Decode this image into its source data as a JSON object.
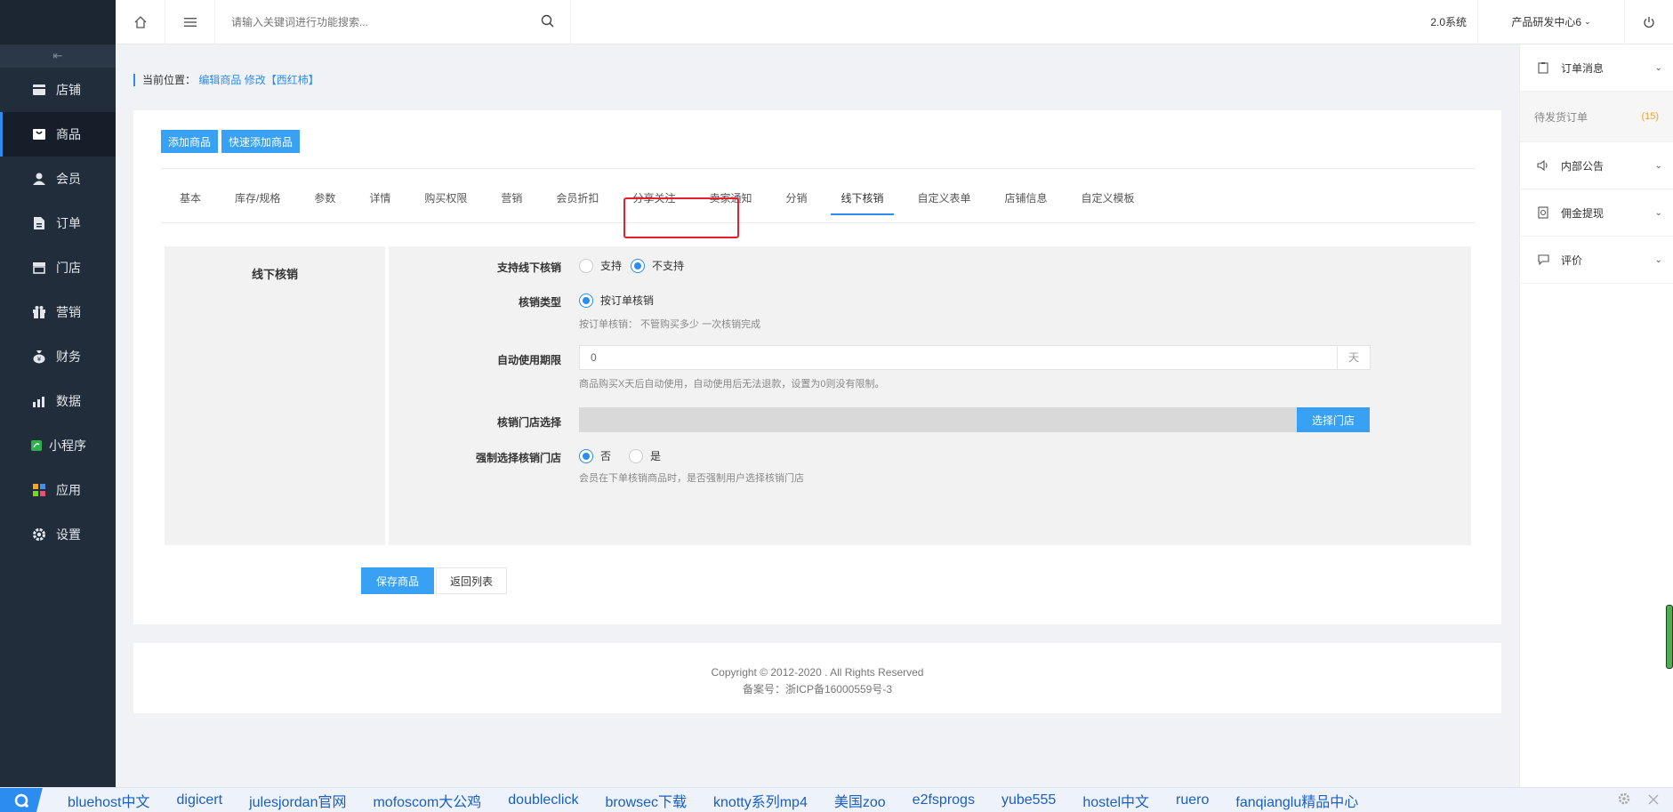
{
  "sidebar": {
    "collapse_glyph": "⇤",
    "items": [
      {
        "label": "店铺",
        "icon": "store-icon"
      },
      {
        "label": "商品",
        "icon": "product-icon",
        "active": true
      },
      {
        "label": "会员",
        "icon": "member-icon"
      },
      {
        "label": "订单",
        "icon": "order-icon"
      },
      {
        "label": "门店",
        "icon": "shop-icon"
      },
      {
        "label": "营销",
        "icon": "gift-icon"
      },
      {
        "label": "财务",
        "icon": "money-bag-icon"
      },
      {
        "label": "数据",
        "icon": "chart-icon"
      },
      {
        "label": "小程序",
        "icon": "miniapp-icon"
      },
      {
        "label": "应用",
        "icon": "apps-icon"
      },
      {
        "label": "设置",
        "icon": "gear-icon"
      }
    ]
  },
  "topbar": {
    "search_placeholder": "请输入关键词进行功能搜索...",
    "system": "2.0系统",
    "org": "产品研发中心6"
  },
  "breadcrumb": {
    "prefix": "当前位置：",
    "links": "编辑商品 修改【西红柿】"
  },
  "actions": {
    "add_product": "添加商品",
    "quick_add": "快速添加商品"
  },
  "tabs": [
    "基本",
    "库存/规格",
    "参数",
    "详情",
    "购买权限",
    "营销",
    "会员折扣",
    "分享关注",
    "卖家通知",
    "分销",
    "线下核销",
    "自定义表单",
    "店铺信息",
    "自定义模板"
  ],
  "active_tab": "线下核销",
  "form": {
    "section_title": "线下核销",
    "support_label": "支持线下核销",
    "support_options": {
      "yes": "支持",
      "no": "不支持"
    },
    "support_selected": "不支持",
    "type_label": "核销类型",
    "type_option": "按订单核销",
    "type_hint": "按订单核销： 不管购买多少 一次核销完成",
    "auto_label": "自动使用期限",
    "auto_value": "0",
    "auto_unit": "天",
    "auto_hint": "商品购买X天后自动使用，自动使用后无法退款，设置为0则没有限制。",
    "store_label": "核销门店选择",
    "store_button": "选择门店",
    "force_label": "强制选择核销门店",
    "force_options": {
      "no": "否",
      "yes": "是"
    },
    "force_selected": "否",
    "force_hint": "会员在下单核销商品时，是否强制用户选择核销门店"
  },
  "buttons": {
    "save": "保存商品",
    "back": "返回列表"
  },
  "footer": {
    "copyright": "Copyright © 2012-2020 . All Rights Reserved",
    "icp": "备案号：浙ICP备16000559号-3"
  },
  "right_panel": {
    "order_msg": "订单消息",
    "pending_label": "待发货订单",
    "pending_count": "(15)",
    "notice": "内部公告",
    "commission": "佣金提现",
    "review": "评价"
  },
  "bookmarks": [
    "bluehost中文",
    "digicert",
    "julesjordan官网",
    "mofoscom大公鸡",
    "doubleclick",
    "browsec下载",
    "knotty系列mp4",
    "美国zoo",
    "e2fsprogs",
    "yube555",
    "hostel中文",
    "ruero",
    "fanqianglu精品中心"
  ],
  "colors": {
    "accent": "#2d8cf0",
    "sidebar": "#212d3b",
    "button": "#39a1f4",
    "highlight": "#e5202e"
  }
}
